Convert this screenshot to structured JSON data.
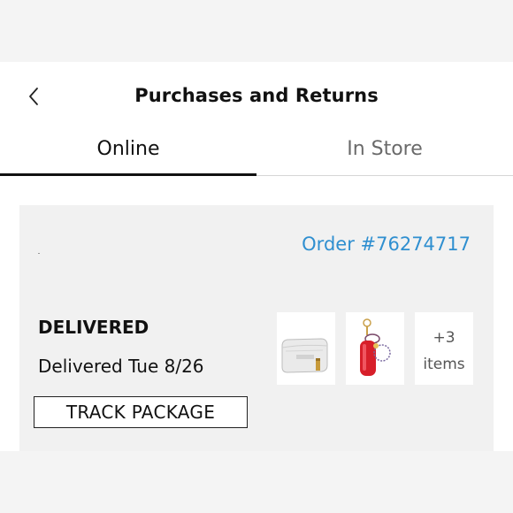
{
  "header": {
    "title": "Purchases and Returns",
    "back_icon": "chevron-left-icon"
  },
  "tabs": [
    {
      "label": "Online",
      "selected": true
    },
    {
      "label": "In Store",
      "selected": false
    }
  ],
  "order": {
    "number_label": "Order #76274717",
    "status": "DELIVERED",
    "delivered_text": "Delivered Tue 8/26",
    "track_button": "TRACK PACKAGE",
    "thumbnails": [
      {
        "name": "white-cosmetic-bag"
      },
      {
        "name": "red-lip-balm-keychain"
      }
    ],
    "more_items": {
      "count": "+3",
      "label": "items"
    }
  },
  "colors": {
    "link": "#2f8fd0",
    "card_bg": "#f1f1f1",
    "tab_indicator": "#111111"
  }
}
